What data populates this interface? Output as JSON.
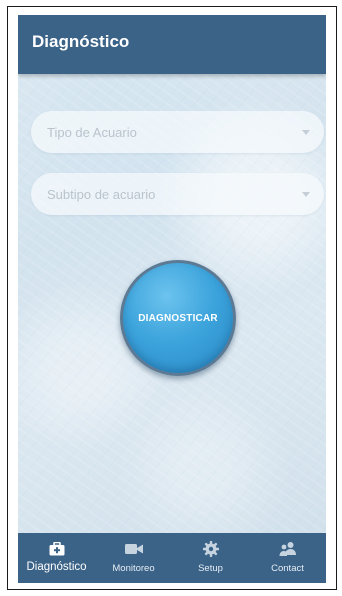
{
  "appbar": {
    "title": "Diagnóstico"
  },
  "form": {
    "aquarium_type": {
      "placeholder": "Tipo de Acuario",
      "icon": "caret-down-icon"
    },
    "aquarium_subtype": {
      "placeholder": "Subtipo de acuario",
      "icon": "caret-down-icon"
    }
  },
  "diagnose_button": {
    "label": "DIAGNOSTICAR"
  },
  "bottom_nav": {
    "items": [
      {
        "label": "Diagnóstico",
        "icon": "medical-kit-icon",
        "active": true
      },
      {
        "label": "Monitoreo",
        "icon": "video-camera-icon",
        "active": false
      },
      {
        "label": "Setup",
        "icon": "gear-icon",
        "active": false
      },
      {
        "label": "Contact",
        "icon": "contacts-icon",
        "active": false
      }
    ]
  },
  "colors": {
    "primary": "#3b6287",
    "button": "#3da4dc",
    "background": "#d8e6f0"
  }
}
